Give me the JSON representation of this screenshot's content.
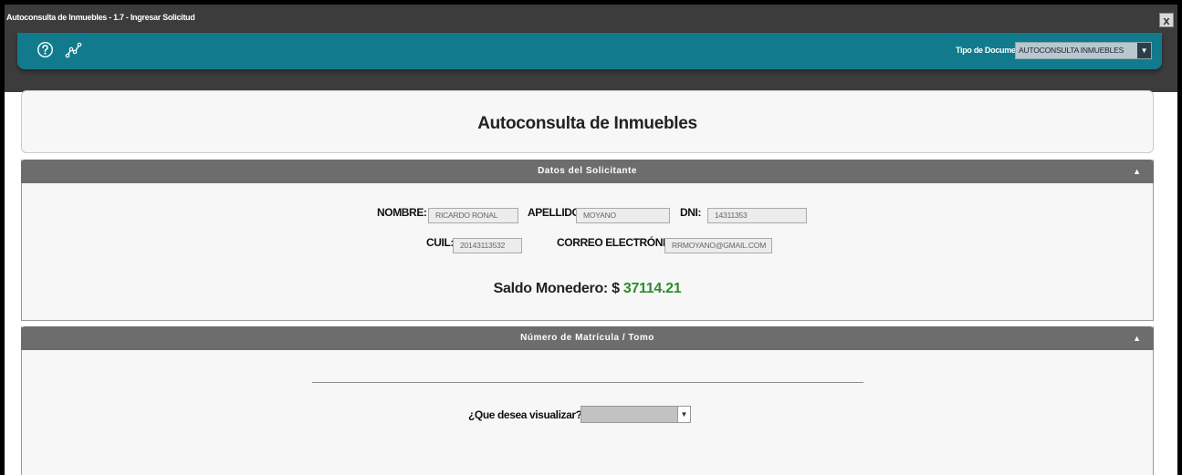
{
  "window": {
    "title": "Autoconsulta de Inmuebles - 1.7 - Ingresar Solicitud",
    "close_label": "x"
  },
  "toolbar": {
    "icons": [
      "help-circle-icon",
      "chart-line-icon"
    ],
    "doc_type_label": "Tipo de Documento:",
    "doc_type_value": "AUTOCONSULTA INMUEBLES",
    "accent_color": "#127a8d"
  },
  "page": {
    "title": "Autoconsulta de Inmuebles"
  },
  "solicitante": {
    "header": "Datos del Solicitante",
    "fields": {
      "nombre": {
        "label": "NOMBRE:",
        "value": "RICARDO RONAL"
      },
      "apellido": {
        "label": "APELLIDO:",
        "value": "MOYANO"
      },
      "dni": {
        "label": "DNI:",
        "value": "14311353"
      },
      "cuil": {
        "label": "CUIL:",
        "value": "20143113532"
      },
      "correo": {
        "label": "CORREO ELECTRÓNICO:",
        "value": "RRMOYANO@GMAIL.COM"
      }
    },
    "saldo_label": "Saldo Monedero: $",
    "saldo_value": "37114.21",
    "saldo_color": "#2e8b2e"
  },
  "matricula": {
    "header": "Número de Matrícula / Tomo",
    "question_label": "¿Que desea visualizar?",
    "question_value": ""
  }
}
